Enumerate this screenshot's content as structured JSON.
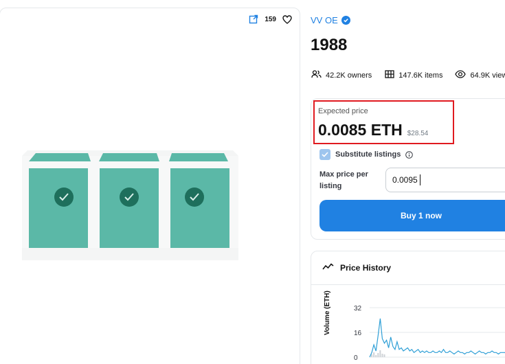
{
  "toolbar": {
    "favorite_count": "159",
    "icons": [
      "open-external-icon",
      "heart-icon"
    ]
  },
  "collection": {
    "name": "VV OE",
    "verified": true
  },
  "item": {
    "title": "1988"
  },
  "stats": {
    "owners": "42.2K owners",
    "items": "147.6K items",
    "views": "64.9K view"
  },
  "buy": {
    "expected_price_label": "Expected price",
    "price_eth": "0.0085 ETH",
    "price_usd": "$28.54",
    "substitute_label": "Substitute listings",
    "substitute_checked": true,
    "max_price_label": "Max price per listing",
    "max_price_value": "0.0095",
    "buy_button_label": "Buy 1 now"
  },
  "price_history": {
    "title": "Price History"
  },
  "colors": {
    "accent": "#2081e2",
    "highlight": "#e0191f",
    "art": "#5bb8a7",
    "chart_line": "#2e9fd6"
  },
  "chart_data": {
    "type": "line",
    "title": "Price History",
    "ylabel": "Volume (ETH)",
    "yticks": [
      "32",
      "16",
      "0"
    ],
    "ylim": [
      0,
      32
    ],
    "grid": true,
    "values": [
      0,
      3,
      8,
      4,
      14,
      25,
      12,
      9,
      11,
      6,
      13,
      7,
      5,
      10,
      5,
      6,
      4,
      5,
      6,
      4,
      5,
      3,
      4,
      5,
      3,
      4,
      3,
      4,
      3,
      3,
      4,
      3,
      3,
      4,
      3,
      5,
      3,
      3,
      4,
      3,
      2,
      3,
      4,
      3,
      3,
      2,
      3,
      3,
      4,
      3,
      2,
      3,
      4,
      3,
      3,
      2,
      3,
      3,
      4,
      3,
      3,
      2,
      3,
      3,
      3,
      2,
      3,
      3,
      4,
      3,
      3
    ]
  }
}
